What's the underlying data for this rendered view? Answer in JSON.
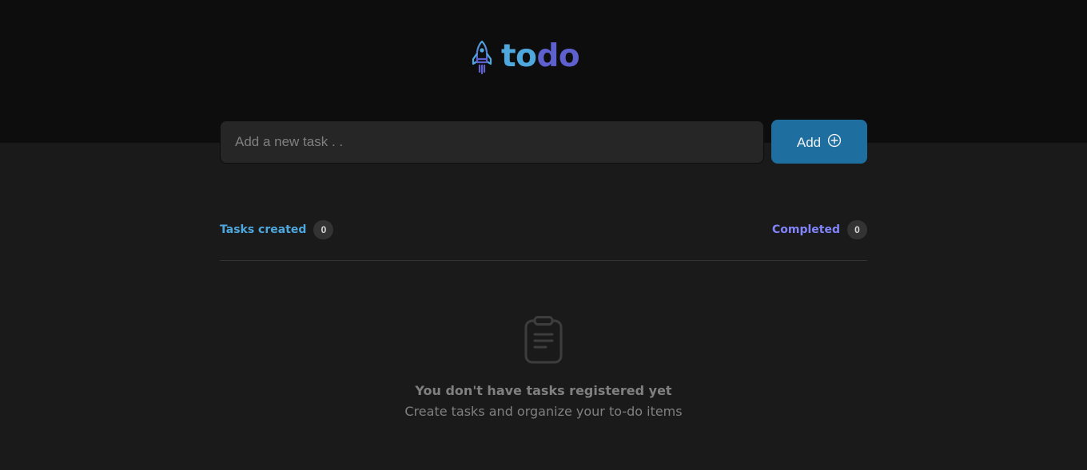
{
  "header": {
    "logo_icon": "rocket-icon",
    "logo_part_1": "to",
    "logo_part_2": "do",
    "colors": {
      "background": "#0d0d0d",
      "logo_to": "#4ea8de",
      "logo_do": "#5e60ce"
    }
  },
  "form": {
    "input_placeholder": "Add a new task . .",
    "input_value": "",
    "add_label": "Add",
    "add_icon": "plus-circle-icon",
    "add_color": "#1e6f9f"
  },
  "counters": {
    "created_label": "Tasks created",
    "created_count": "0",
    "created_color": "#4ea8de",
    "completed_label": "Completed",
    "completed_count": "0",
    "completed_color": "#8284fa"
  },
  "empty_state": {
    "icon": "clipboard-icon",
    "title": "You don't have tasks registered yet",
    "subtitle": "Create tasks and organize your to-do items"
  }
}
